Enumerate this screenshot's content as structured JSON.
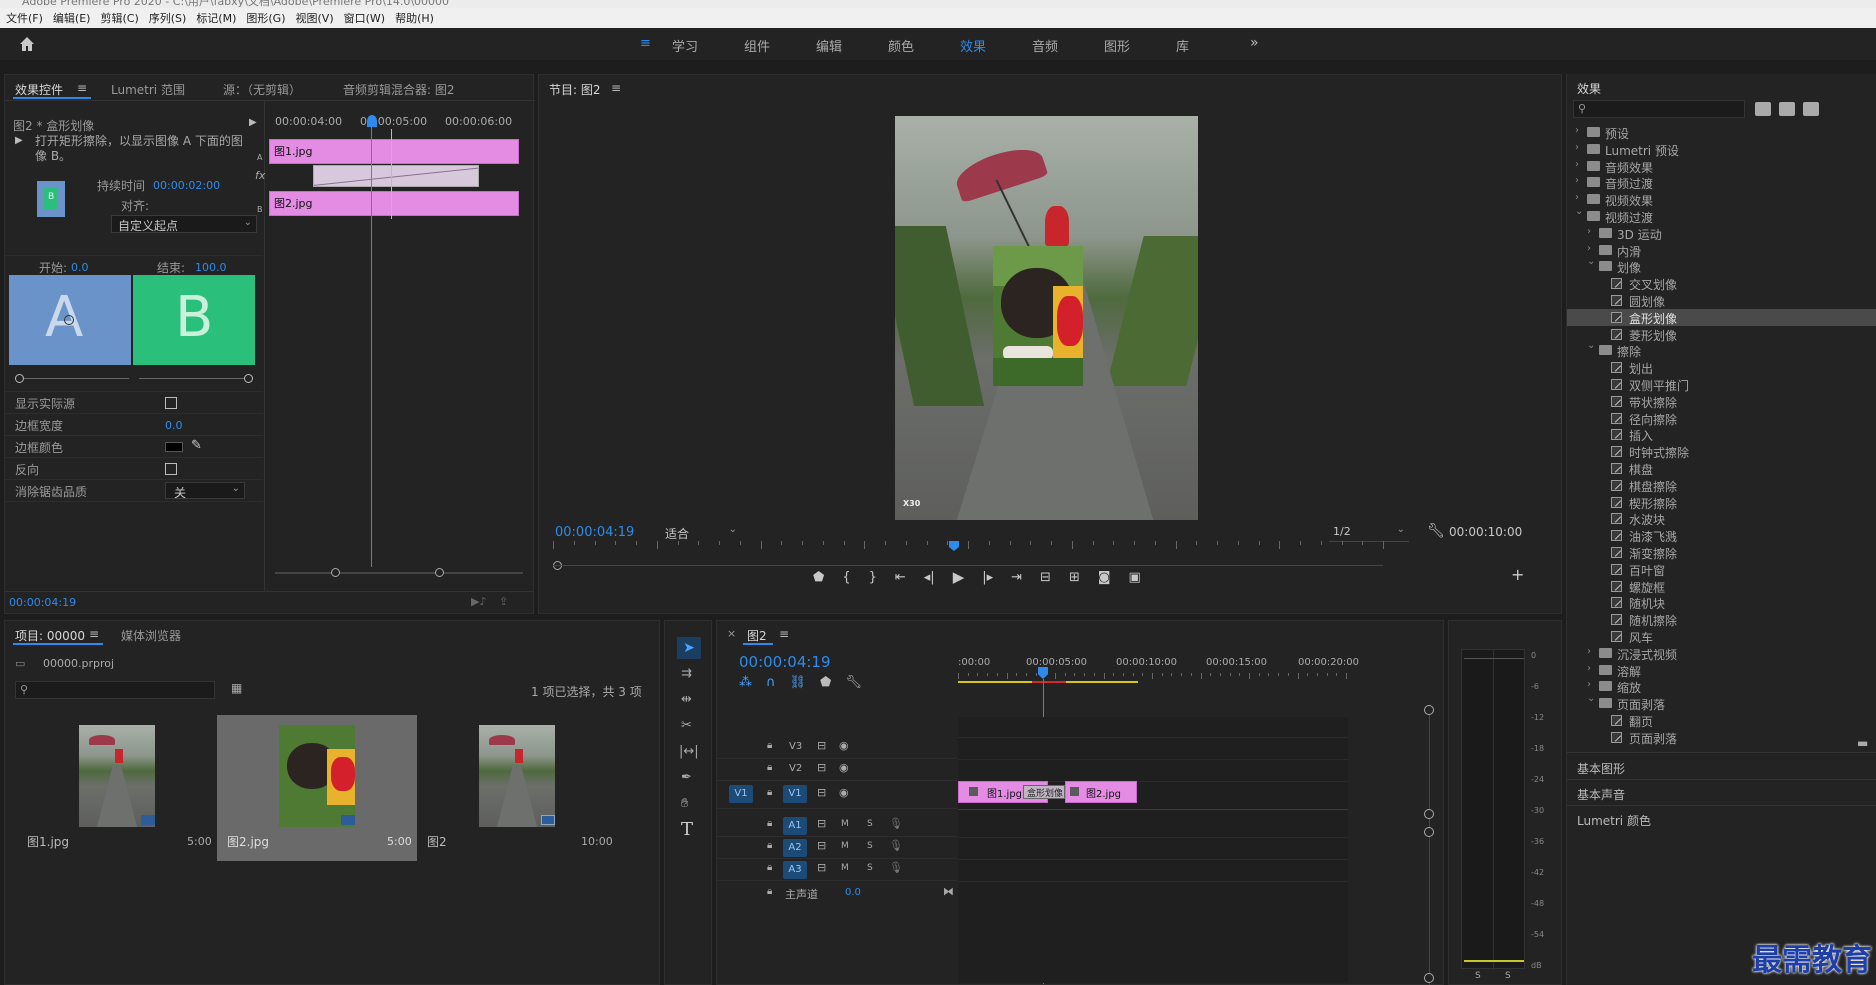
{
  "title_bar": {
    "text": "Adobe Premiere Pro 2020 - C:\\用户\\fabxy\\文档\\Adobe\\Premiere Pro\\14.0\\00000"
  },
  "menu": [
    "文件(F)",
    "编辑(E)",
    "剪辑(C)",
    "序列(S)",
    "标记(M)",
    "图形(G)",
    "视图(V)",
    "窗口(W)",
    "帮助(H)"
  ],
  "workspaces": [
    "学习",
    "组件",
    "编辑",
    "颜色",
    "效果",
    "音频",
    "图形",
    "库"
  ],
  "active_workspace": "效果",
  "effect_controls": {
    "tabs": [
      "效果控件",
      "Lumetri 范围",
      "源：（无剪辑）",
      "音频剪辑混合器: 图2"
    ],
    "clip_name": "图2 * 盒形划像",
    "description": "打开矩形擦除，以显示图像 A 下面的图像 B。",
    "duration_label": "持续时间",
    "duration_value": "00:00:02:00",
    "align_label": "对齐:",
    "align_value": "自定义起点",
    "start_label": "开始:",
    "start_value": "0.0",
    "end_label": "结束:",
    "end_value": "100.0",
    "thumb_a": "A",
    "thumb_b": "B",
    "ruler": [
      "00:00:04:00",
      "00:00:05:00",
      "00:00:06:00"
    ],
    "track_a": "A",
    "track_b": "B",
    "track_fx": "fx",
    "clip_a": "图1.jpg",
    "clip_b": "图2.jpg",
    "props": [
      {
        "label": "显示实际源",
        "type": "checkbox",
        "value": ""
      },
      {
        "label": "边框宽度",
        "type": "number",
        "value": "0.0"
      },
      {
        "label": "边框颜色",
        "type": "color",
        "value": ""
      },
      {
        "label": "反向",
        "type": "checkbox",
        "value": ""
      },
      {
        "label": "消除锯齿品质",
        "type": "select",
        "value": "关"
      }
    ],
    "timecode": "00:00:04:19"
  },
  "program": {
    "title": "节目: 图2",
    "timecode": "00:00:04:19",
    "fit": "适合",
    "resolution": "1/2",
    "duration": "00:00:10:00",
    "watermark": "X30"
  },
  "effects": {
    "title": "效果",
    "search_placeholder": "",
    "tree": [
      {
        "level": 0,
        "kind": "folder",
        "open": false,
        "label": "预设"
      },
      {
        "level": 0,
        "kind": "folder",
        "open": false,
        "label": "Lumetri 预设"
      },
      {
        "level": 0,
        "kind": "folder",
        "open": false,
        "label": "音频效果"
      },
      {
        "level": 0,
        "kind": "folder",
        "open": false,
        "label": "音频过渡"
      },
      {
        "level": 0,
        "kind": "folder",
        "open": false,
        "label": "视频效果"
      },
      {
        "level": 0,
        "kind": "folder",
        "open": true,
        "label": "视频过渡"
      },
      {
        "level": 1,
        "kind": "folder",
        "open": false,
        "label": "3D 运动"
      },
      {
        "level": 1,
        "kind": "folder",
        "open": false,
        "label": "内滑"
      },
      {
        "level": 1,
        "kind": "folder",
        "open": true,
        "label": "划像"
      },
      {
        "level": 2,
        "kind": "fx",
        "label": "交叉划像"
      },
      {
        "level": 2,
        "kind": "fx",
        "label": "圆划像"
      },
      {
        "level": 2,
        "kind": "fx",
        "label": "盒形划像",
        "selected": true
      },
      {
        "level": 2,
        "kind": "fx",
        "label": "菱形划像"
      },
      {
        "level": 1,
        "kind": "folder",
        "open": true,
        "label": "擦除"
      },
      {
        "level": 2,
        "kind": "fx",
        "label": "划出"
      },
      {
        "level": 2,
        "kind": "fx",
        "label": "双侧平推门"
      },
      {
        "level": 2,
        "kind": "fx",
        "label": "带状擦除"
      },
      {
        "level": 2,
        "kind": "fx",
        "label": "径向擦除"
      },
      {
        "level": 2,
        "kind": "fx",
        "label": "插入"
      },
      {
        "level": 2,
        "kind": "fx",
        "label": "时钟式擦除"
      },
      {
        "level": 2,
        "kind": "fx",
        "label": "棋盘"
      },
      {
        "level": 2,
        "kind": "fx",
        "label": "棋盘擦除"
      },
      {
        "level": 2,
        "kind": "fx",
        "label": "楔形擦除"
      },
      {
        "level": 2,
        "kind": "fx",
        "label": "水波块"
      },
      {
        "level": 2,
        "kind": "fx",
        "label": "油漆飞溅"
      },
      {
        "level": 2,
        "kind": "fx",
        "label": "渐变擦除"
      },
      {
        "level": 2,
        "kind": "fx",
        "label": "百叶窗"
      },
      {
        "level": 2,
        "kind": "fx",
        "label": "螺旋框"
      },
      {
        "level": 2,
        "kind": "fx",
        "label": "随机块"
      },
      {
        "level": 2,
        "kind": "fx",
        "label": "随机擦除"
      },
      {
        "level": 2,
        "kind": "fx",
        "label": "风车"
      },
      {
        "level": 1,
        "kind": "folder",
        "open": false,
        "label": "沉浸式视频"
      },
      {
        "level": 1,
        "kind": "folder",
        "open": false,
        "label": "溶解"
      },
      {
        "level": 1,
        "kind": "folder",
        "open": false,
        "label": "缩放"
      },
      {
        "level": 1,
        "kind": "folder",
        "open": true,
        "label": "页面剥落"
      },
      {
        "level": 2,
        "kind": "fx",
        "label": "翻页"
      },
      {
        "level": 2,
        "kind": "fx",
        "label": "页面剥落"
      }
    ],
    "sections": [
      "基本图形",
      "基本声音",
      "Lumetri 颜色"
    ]
  },
  "project": {
    "tabs": [
      "项目: 00000",
      "媒体浏览器"
    ],
    "file": "00000.prproj",
    "selection_info": "1 项已选择，共 3 项",
    "items": [
      {
        "name": "图1.jpg",
        "duration": "5:00"
      },
      {
        "name": "图2.jpg",
        "duration": "5:00"
      },
      {
        "name": "图2",
        "duration": "10:00"
      }
    ]
  },
  "timeline": {
    "title": "图2",
    "timecode": "00:00:04:19",
    "ruler": [
      ":00:00",
      "00:00:05:00",
      "00:00:10:00",
      "00:00:15:00",
      "00:00:20:00"
    ],
    "video_tracks": [
      "V3",
      "V2",
      "V1"
    ],
    "audio_tracks": [
      "A1",
      "A2",
      "A3"
    ],
    "source_patch": "V1",
    "master_label": "主声道",
    "master_value": "0.0",
    "mute": "M",
    "solo": "S",
    "clip1": "图1.jpg",
    "transition": "盒形划像",
    "clip2": "图2.jpg"
  },
  "audio_meter": {
    "scale": [
      "0",
      "-6",
      "-12",
      "-18",
      "-24",
      "-30",
      "-36",
      "-42",
      "-48",
      "-54",
      "dB"
    ],
    "solo_left": "S",
    "solo_right": "S"
  },
  "watermark": "最需教育",
  "colors": {
    "accent": "#2d8ceb",
    "clip": "#e48ce4",
    "thumb_a": "#6a93c9",
    "thumb_b": "#2bbf7c"
  }
}
